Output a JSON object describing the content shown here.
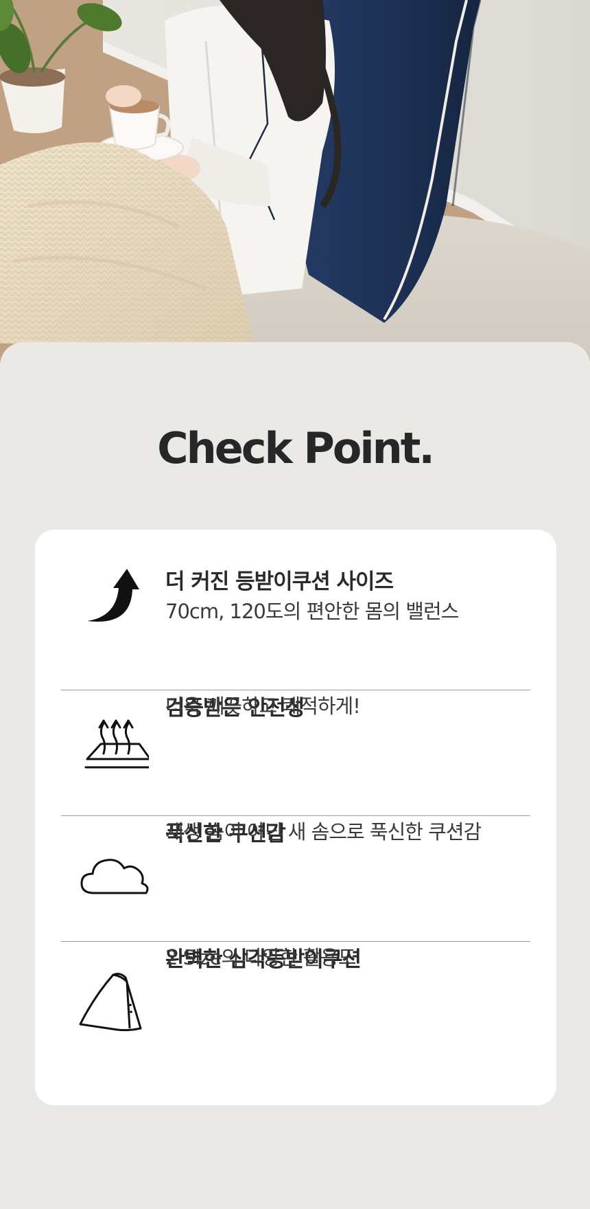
{
  "headline": "Check Point.",
  "points": [
    {
      "icon": "curved-arrow-up-icon",
      "title": "더 커진 등받이쿠션 사이즈",
      "desc": "70cm, 120도의 편안한 몸의 밸런스"
    },
    {
      "icon": "breathable-layer-icon",
      "title": "검증받은 안전성",
      "desc": "더욱 깨끗하고 쾌적하게!"
    },
    {
      "icon": "cloud-icon",
      "title": "푹신한 쿠션감",
      "desc": "재생 솜이 아닌 새 솜으로 푹신한 쿠션감"
    },
    {
      "icon": "triangle-cushion-icon",
      "title": "완벽한 삼각등받이쿠션",
      "desc": "2 Size의 다양한 활용도"
    }
  ],
  "colors": {
    "page_background": "#ebe9e6",
    "card_background": "#ffffff",
    "text_dark": "#2a2a2a",
    "cushion_navy": "#1f3358"
  }
}
